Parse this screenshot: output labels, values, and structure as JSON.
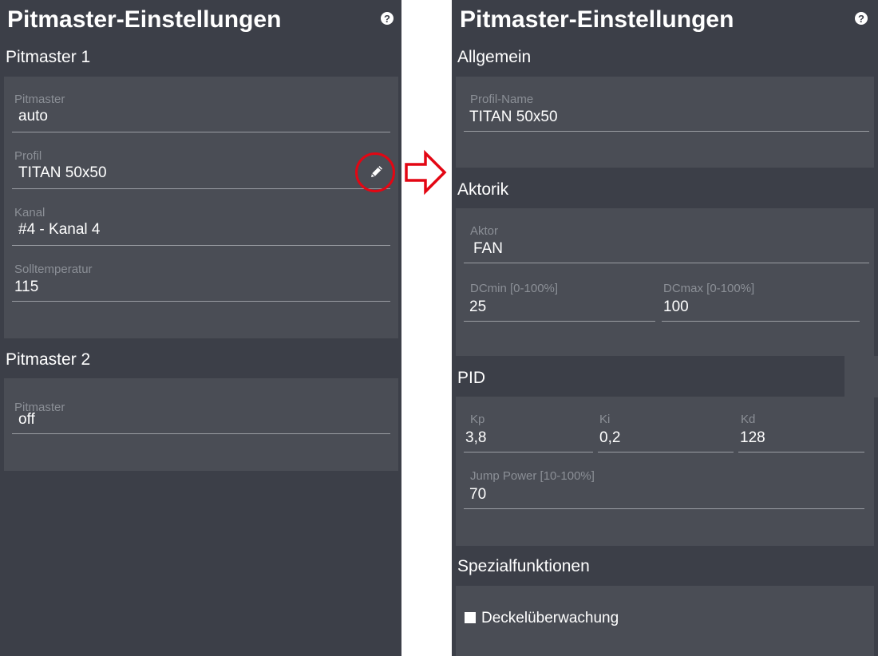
{
  "left": {
    "title": "Pitmaster-Einstellungen",
    "help_icon": "?",
    "pitmaster1": {
      "title": "Pitmaster 1",
      "pitmaster_label": "Pitmaster",
      "pitmaster_value": "auto",
      "profil_label": "Profil",
      "profil_value": "TITAN 50x50",
      "kanal_label": "Kanal",
      "kanal_value": "#4 - Kanal 4",
      "soll_label": "Solltemperatur",
      "soll_value": "115"
    },
    "pitmaster2": {
      "title": "Pitmaster 2",
      "pitmaster_label": "Pitmaster",
      "pitmaster_value": "off"
    },
    "edit_icon": "pencil-icon",
    "highlight_color": "#e30613"
  },
  "arrow_icon": "right-arrow-icon",
  "right": {
    "title": "Pitmaster-Einstellungen",
    "help_icon": "?",
    "allgemein": {
      "title": "Allgemein",
      "profilname_label": "Profil-Name",
      "profilname_value": "TITAN 50x50"
    },
    "aktorik": {
      "title": "Aktorik",
      "aktor_label": "Aktor",
      "aktor_value": "FAN",
      "dcmin_label": "DCmin [0-100%]",
      "dcmin_value": "25",
      "dcmax_label": "DCmax [0-100%]",
      "dcmax_value": "100"
    },
    "pid": {
      "title": "PID",
      "kp_label": "Kp",
      "kp_value": "3,8",
      "ki_label": "Ki",
      "ki_value": "0,2",
      "kd_label": "Kd",
      "kd_value": "128",
      "jump_label": "Jump Power [10-100%]",
      "jump_value": "70"
    },
    "spezial": {
      "title": "Spezialfunktionen",
      "deckel_label": "Deckelüberwachung",
      "deckel_checked": false
    }
  },
  "colors": {
    "panel_bg": "#3c3f48",
    "card_bg": "#4a4d55",
    "label": "#8b8f96",
    "accent_red": "#e30613"
  }
}
